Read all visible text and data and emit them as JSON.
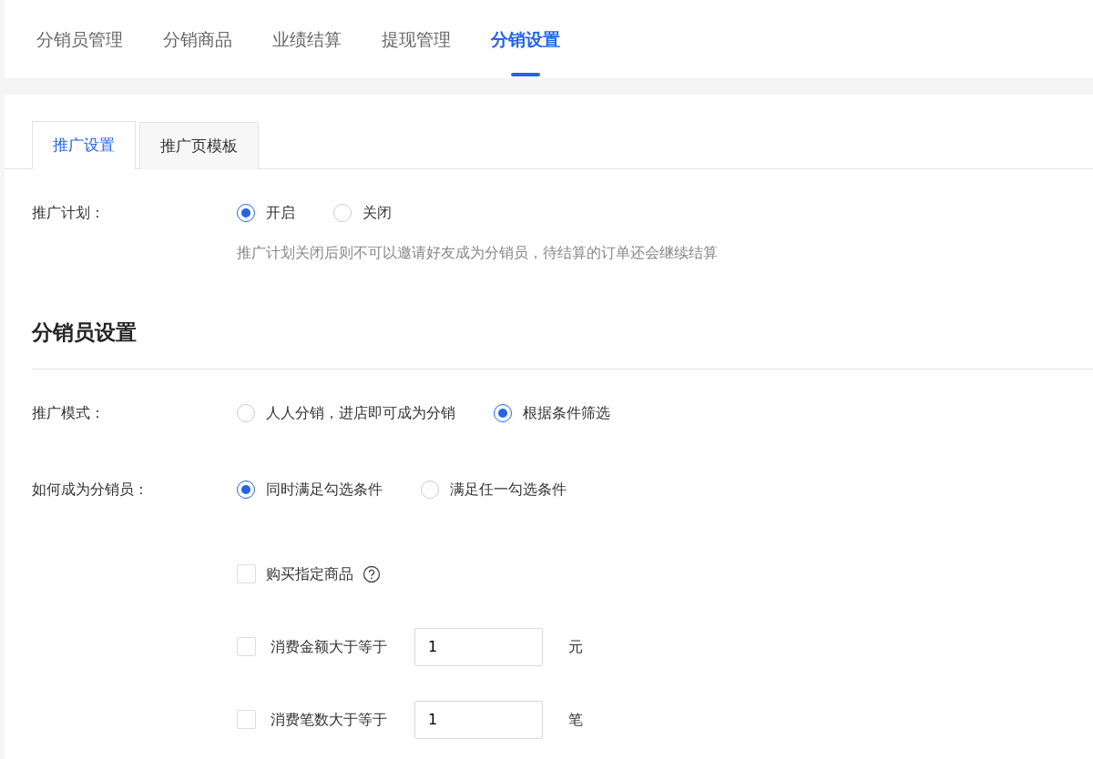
{
  "nav_tabs": [
    {
      "label": "分销员管理",
      "selected": false
    },
    {
      "label": "分销商品",
      "selected": false
    },
    {
      "label": "业绩结算",
      "selected": false
    },
    {
      "label": "提现管理",
      "selected": false
    },
    {
      "label": "分销设置",
      "selected": true
    }
  ],
  "sub_tabs": [
    {
      "label": "推广设置",
      "selected": true
    },
    {
      "label": "推广页模板",
      "selected": false
    }
  ],
  "promotion_plan": {
    "label": "推广计划：",
    "options": [
      {
        "label": "开启",
        "selected": true
      },
      {
        "label": "关闭",
        "selected": false
      }
    ],
    "hint": "推广计划关闭后则不可以邀请好友成为分销员，待结算的订单还会继续结算"
  },
  "section_title": "分销员设置",
  "promotion_mode": {
    "label": "推广模式：",
    "options": [
      {
        "label": "人人分销，进店即可成为分销",
        "selected": false
      },
      {
        "label": "根据条件筛选",
        "selected": true
      }
    ]
  },
  "how_to_become": {
    "label": "如何成为分销员：",
    "options": [
      {
        "label": "同时满足勾选条件",
        "selected": true
      },
      {
        "label": "满足任一勾选条件",
        "selected": false
      }
    ]
  },
  "conditions": [
    {
      "kind": "plain",
      "label": "购买指定商品",
      "checked": false,
      "help": true
    },
    {
      "kind": "threshold",
      "label": "消费金额大于等于",
      "checked": false,
      "value": "1",
      "unit": "元"
    },
    {
      "kind": "threshold",
      "label": "消费笔数大于等于",
      "checked": false,
      "value": "1",
      "unit": "笔"
    }
  ]
}
